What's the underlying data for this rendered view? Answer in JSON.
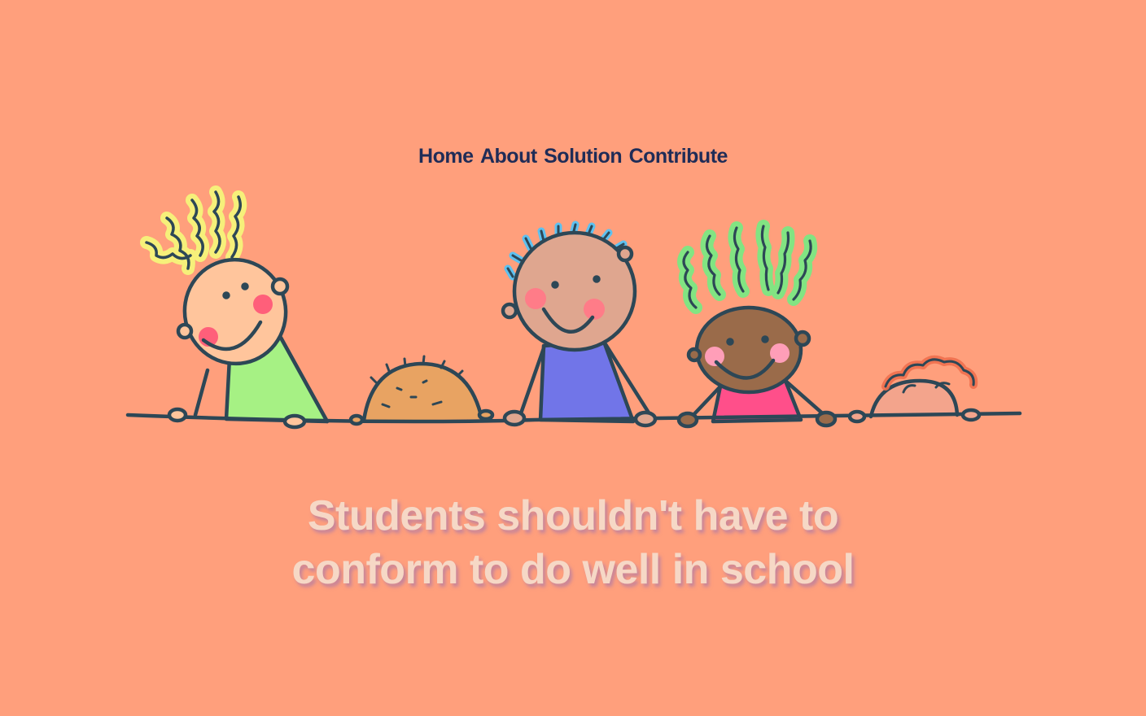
{
  "nav": {
    "items": [
      "Home",
      "About",
      "Solution",
      "Contribute"
    ]
  },
  "hero": {
    "headline_line1": "Students shouldn't have to",
    "headline_line2": "conform to do well in school"
  },
  "colors": {
    "background": "#ff9f7c",
    "nav_text": "#1f2c57",
    "headline_text": "#f6d8c6",
    "outline": "#2d4756"
  },
  "illustration": {
    "icon": "children-peeking-over-wall-illustration"
  }
}
